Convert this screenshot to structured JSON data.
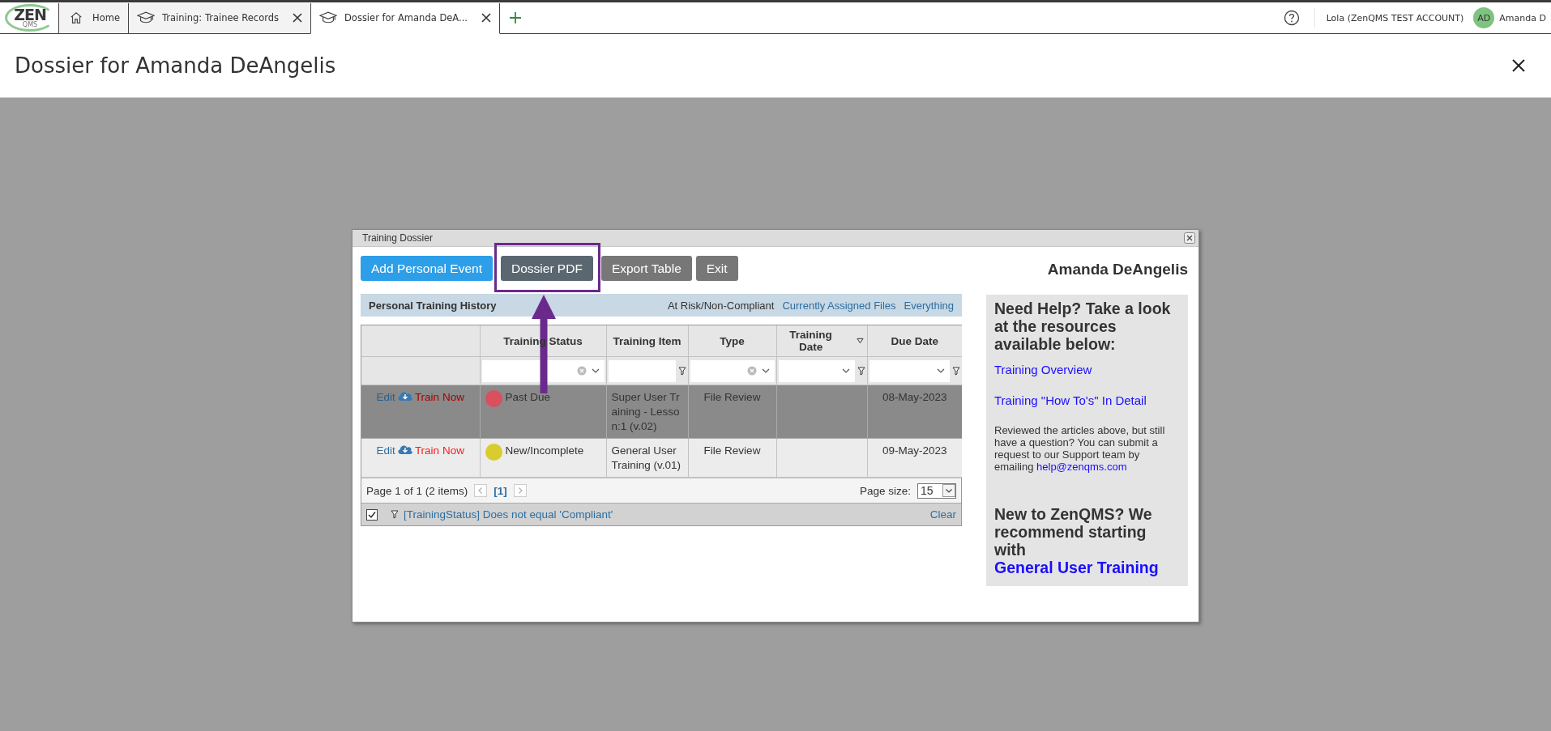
{
  "top_bar": {
    "logo": {
      "text": "ZEN",
      "subtext": "QMS"
    },
    "tabs": [
      {
        "label": "Home",
        "kind": "home",
        "closable": false,
        "selected": false
      },
      {
        "label": "Training: Trainee Records",
        "kind": "training",
        "closable": true,
        "selected": false
      },
      {
        "label": "Dossier for Amanda DeA...",
        "kind": "training",
        "closable": true,
        "selected": true
      }
    ],
    "account": "Lola (ZenQMS TEST ACCOUNT)",
    "avatar": "AD",
    "user": "Amanda D"
  },
  "page": {
    "title": "Dossier for Amanda DeAngelis"
  },
  "dialog": {
    "title": "Training Dossier",
    "buttons": [
      {
        "label": "Add Personal Event",
        "kind": "primary",
        "highlighted": false
      },
      {
        "label": "Dossier PDF",
        "kind": "dark",
        "highlighted": true
      },
      {
        "label": "Export Table",
        "kind": "secondary",
        "highlighted": false
      },
      {
        "label": "Exit",
        "kind": "secondary",
        "highlighted": false
      }
    ],
    "person": "Amanda DeAngelis",
    "history": {
      "title": "Personal Training History",
      "views": [
        {
          "label": "At Risk/Non-Compliant",
          "selected": true
        },
        {
          "label": "Currently Assigned Files",
          "selected": false
        },
        {
          "label": "Everything",
          "selected": false
        }
      ]
    },
    "table": {
      "columns": [
        {
          "label": "Training Status",
          "kind": "combo",
          "has_menu": false
        },
        {
          "label": "Training Item",
          "kind": "text",
          "has_menu": false
        },
        {
          "label": "Type",
          "kind": "combo",
          "has_menu": false
        },
        {
          "label": "Training Date",
          "kind": "select",
          "has_menu": true
        },
        {
          "label": "Due Date",
          "kind": "select",
          "has_menu": false
        }
      ],
      "rows": [
        {
          "selected": true,
          "edit": "Edit",
          "train": "Train Now",
          "status": "Past Due",
          "color": "#d9505f",
          "item": "Super User Training - Lesson:1 (v.02)",
          "type": "File Review",
          "due": "08-May-2023"
        },
        {
          "selected": false,
          "edit": "Edit",
          "train": "Train Now",
          "status": "New/Incomplete",
          "color": "#d9cc2e",
          "item": "General User Training (v.01)",
          "type": "File Review",
          "due": "09-May-2023"
        }
      ],
      "pager": {
        "summary": "Page 1 of 1 (2 items)",
        "current": "[1]",
        "size_label": "Page size:",
        "size": "15"
      },
      "filter": {
        "enabled": true,
        "text": "[TrainingStatus] Does not equal 'Compliant'",
        "clear": "Clear"
      }
    },
    "help": {
      "heading": "Need Help? Take a look at the resources available below:",
      "links": [
        "Training Overview",
        "Training \"How To's\" In Detail"
      ],
      "note": "Reviewed the articles above, but still have a question? You can submit a request to our Support team by emailing",
      "email": "help@zenqms.com",
      "recommend": "New to ZenQMS? We recommend starting with",
      "recommend_link": "General User Training"
    }
  }
}
